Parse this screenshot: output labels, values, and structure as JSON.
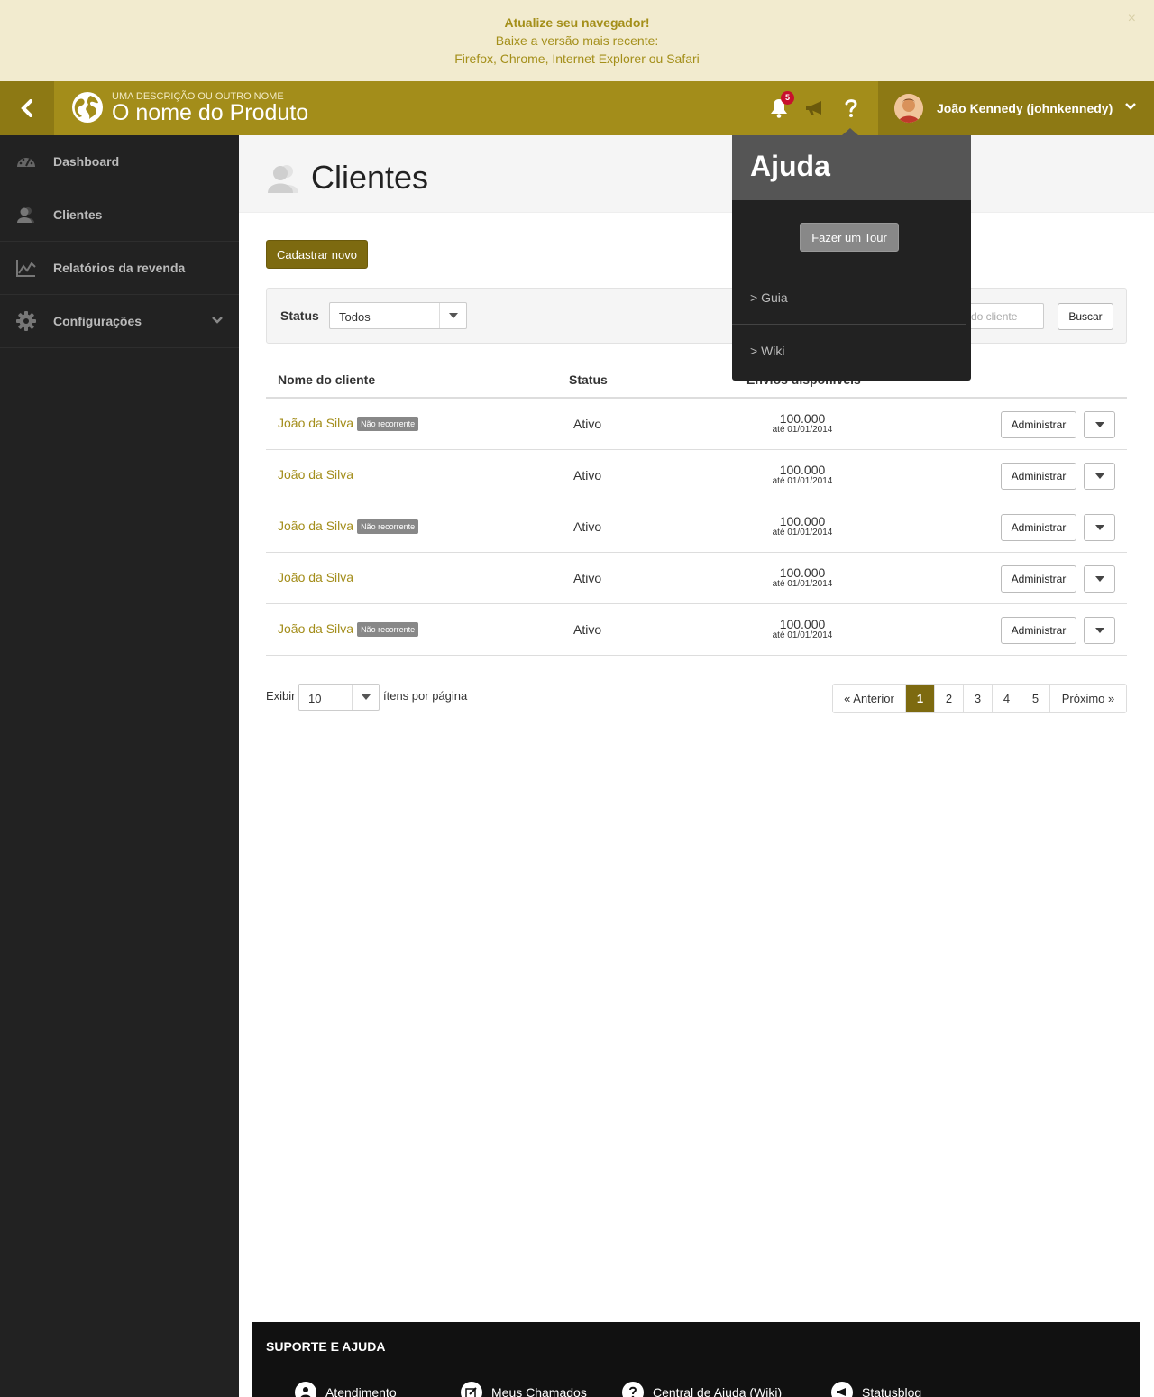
{
  "alert": {
    "title": "Atualize seu navegador!",
    "line2": "Baixe a versão mais recente:",
    "line3": "Firefox, Chrome, Internet Explorer ou Safari",
    "close": "×"
  },
  "header": {
    "brand_desc": "UMA DESCRIÇÃO OU OUTRO NOME",
    "brand_name": "O nome do Produto",
    "notification_count": "5",
    "user_name": "João Kennedy (johnkennedy)"
  },
  "sidebar": {
    "items": [
      {
        "label": "Dashboard",
        "icon": "dashboard-icon"
      },
      {
        "label": "Clientes",
        "icon": "users-icon"
      },
      {
        "label": "Relatórios da revenda",
        "icon": "chart-icon"
      },
      {
        "label": "Configurações",
        "icon": "gear-icon"
      }
    ]
  },
  "page": {
    "title": "Clientes",
    "new_button": "Cadastrar novo",
    "status_label": "Status",
    "status_value": "Todos",
    "search_placeholder": "do cliente",
    "search_button": "Buscar"
  },
  "table": {
    "headers": {
      "name": "Nome do cliente",
      "status": "Status",
      "envios": "Envios disponíveis"
    },
    "rows": [
      {
        "name": "João da Silva",
        "tag": "Não recorrente",
        "status": "Ativo",
        "envios": "100.000",
        "date": "até 01/01/2014",
        "action": "Administrar"
      },
      {
        "name": "João da Silva",
        "tag": "",
        "status": "Ativo",
        "envios": "100.000",
        "date": "até 01/01/2014",
        "action": "Administrar"
      },
      {
        "name": "João da Silva",
        "tag": "Não recorrente",
        "status": "Ativo",
        "envios": "100.000",
        "date": "até 01/01/2014",
        "action": "Administrar"
      },
      {
        "name": "João da Silva",
        "tag": "",
        "status": "Ativo",
        "envios": "100.000",
        "date": "até 01/01/2014",
        "action": "Administrar"
      },
      {
        "name": "João da Silva",
        "tag": "Não recorrente",
        "status": "Ativo",
        "envios": "100.000",
        "date": "até 01/01/2014",
        "action": "Administrar"
      }
    ]
  },
  "pagination": {
    "show_label": "Exibir",
    "per_page": "10",
    "per_page_suffix": "ítens por página",
    "prev": "« Anterior",
    "pages": [
      "1",
      "2",
      "3",
      "4",
      "5"
    ],
    "active_page": "1",
    "next": "Próximo »"
  },
  "help_popover": {
    "title": "Ajuda",
    "tour_button": "Fazer um Tour",
    "links": [
      "> Guia",
      "> Wiki"
    ]
  },
  "footer": {
    "title": "SUPORTE E AJUDA",
    "items": [
      {
        "label": "Atendimento",
        "icon": "user-icon"
      },
      {
        "label": "Meus Chamados",
        "icon": "edit-icon"
      },
      {
        "label": "Central de Ajuda (Wiki)",
        "icon": "question-icon"
      },
      {
        "label": "Statusblog",
        "icon": "megaphone-icon"
      }
    ]
  },
  "colors": {
    "brand": "#a38d1a",
    "brand_dark": "#7d6a10",
    "sidebar": "#222222",
    "alert_bg": "#f2ebcf"
  }
}
